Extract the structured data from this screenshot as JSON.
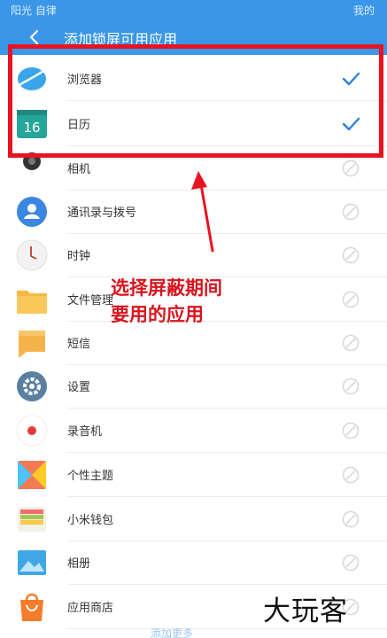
{
  "status_bar": {
    "left": "阳光 自律",
    "right": "我的"
  },
  "title_bar": {
    "title": "添加锁屏可用应用"
  },
  "apps": [
    {
      "label": "浏览器",
      "state": "checked",
      "icon": "browser-icon",
      "color": "#39a6ea"
    },
    {
      "label": "日历",
      "state": "checked",
      "icon": "calendar-icon",
      "color": "#26a69a",
      "icon_text": "16"
    },
    {
      "label": "相机",
      "state": "off",
      "icon": "camera-icon",
      "color": "#333333"
    },
    {
      "label": "通讯录与拨号",
      "state": "off",
      "icon": "contacts-icon",
      "color": "#3a86e0"
    },
    {
      "label": "时钟",
      "state": "off",
      "icon": "clock-icon",
      "color": "#f2f2f2"
    },
    {
      "label": "文件管理",
      "state": "off",
      "icon": "folder-icon",
      "color": "#f5b942"
    },
    {
      "label": "短信",
      "state": "off",
      "icon": "messages-icon",
      "color": "#f6b24a"
    },
    {
      "label": "设置",
      "state": "off",
      "icon": "settings-icon",
      "color": "#5a7fa0"
    },
    {
      "label": "录音机",
      "state": "off",
      "icon": "recorder-icon",
      "color": "#e53935"
    },
    {
      "label": "个性主题",
      "state": "off",
      "icon": "themes-icon",
      "color": "#f27a54"
    },
    {
      "label": "小米钱包",
      "state": "off",
      "icon": "wallet-icon",
      "color": "#a8c64e"
    },
    {
      "label": "相册",
      "state": "off",
      "icon": "gallery-icon",
      "color": "#3fa7e6"
    },
    {
      "label": "应用商店",
      "state": "off",
      "icon": "app-store-icon",
      "color": "#f47c2c"
    }
  ],
  "annotation": {
    "line1": "选择屏蔽期间",
    "line2": "要用的应用"
  },
  "watermark": "大玩客",
  "bottom_link": "添加更多",
  "colors": {
    "accent": "#3a96e8",
    "check": "#2d7fd6",
    "highlight": "#e8131f",
    "disabled": "#d8d8d8"
  }
}
